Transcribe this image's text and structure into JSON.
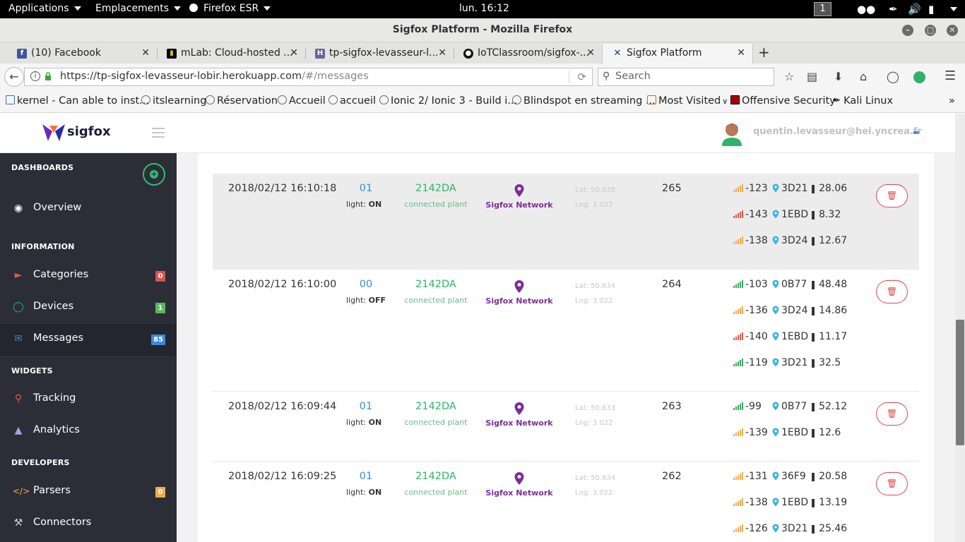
{
  "system_bar": {
    "applications": "Applications",
    "places": "Emplacements",
    "firefox": "Firefox ESR",
    "clock": "lun. 16:12",
    "workspace": "1"
  },
  "window": {
    "title": "Sigfox Platform - Mozilla Firefox"
  },
  "tabs": [
    {
      "label": "(10) Facebook",
      "icon_color": "#3b5998",
      "icon_glyph": "f"
    },
    {
      "label": "mLab: Cloud-hosted ...",
      "icon_color": "#000000",
      "icon_glyph": "▮"
    },
    {
      "label": "tp-sigfox-levasseur-l...",
      "icon_color": "#6762a6",
      "icon_glyph": "H"
    },
    {
      "label": "IoTClassroom/sigfox-...",
      "icon_color": "#111111",
      "icon_glyph": "●"
    },
    {
      "label": "Sigfox Platform",
      "icon_color": "#2a2aa8",
      "icon_glyph": "✕"
    }
  ],
  "navbar": {
    "url_host": "https://tp-sigfox-levasseur-lobir.herokuapp.com",
    "url_path": "/#/messages",
    "search_placeholder": "Search"
  },
  "bookmarks": [
    "kernel - Can able to inst...",
    "itslearning",
    "Réservation",
    "Accueil",
    "accueil",
    "Ionic 2/ Ionic 3 - Build i...",
    "Blindspot en streaming ...",
    "Most Visited",
    "Offensive Security",
    "Kali Linux"
  ],
  "app": {
    "logo_text": "sigfox",
    "user_email": "quentin.levasseur@hei.yncrea.fr"
  },
  "sidebar": {
    "sections": [
      "DASHBOARDS",
      "INFORMATION",
      "WIDGETS",
      "DEVELOPERS"
    ],
    "items": [
      {
        "label": "Overview",
        "icon": "dashboard-icon"
      },
      {
        "label": "Categories",
        "icon": "tag-icon",
        "badge": "0",
        "badge_color": "#d9534f"
      },
      {
        "label": "Devices",
        "icon": "thermometer-icon",
        "badge": "1",
        "badge_color": "#5cb85c"
      },
      {
        "label": "Messages",
        "icon": "envelope-icon",
        "badge": "85",
        "badge_color": "#3a8bd6",
        "active": true
      },
      {
        "label": "Tracking",
        "icon": "map-marker-icon"
      },
      {
        "label": "Analytics",
        "icon": "area-chart-icon"
      },
      {
        "label": "Parsers",
        "icon": "code-icon",
        "badge": "0",
        "badge_color": "#f0ad4e"
      },
      {
        "label": "Connectors",
        "icon": "wrench-icon"
      }
    ]
  },
  "messages": [
    {
      "date": "2018/02/12 16:10:18",
      "data": "01",
      "light_label": "light:",
      "light": "ON",
      "device": "2142DA",
      "device_name": "connected plant",
      "network": "Sigfox Network",
      "lat": "Lat: 50.635",
      "lng": "Lng: 3.022",
      "seq": "265",
      "stations": [
        {
          "rssi": "-123",
          "id": "3D21",
          "snr": "28.06",
          "signal_color": "#f0ad4e"
        },
        {
          "rssi": "-143",
          "id": "1EBD",
          "snr": "8.32",
          "signal_color": "#e05a4a"
        },
        {
          "rssi": "-138",
          "id": "3D24",
          "snr": "12.67",
          "signal_color": "#f0ad4e"
        }
      ]
    },
    {
      "date": "2018/02/12 16:10:00",
      "data": "00",
      "light_label": "light:",
      "light": "OFF",
      "device": "2142DA",
      "device_name": "connected plant",
      "network": "Sigfox Network",
      "lat": "Lat: 50.634",
      "lng": "Lng: 3.022",
      "seq": "264",
      "stations": [
        {
          "rssi": "-103",
          "id": "0B77",
          "snr": "48.48",
          "signal_color": "#3aaa5c"
        },
        {
          "rssi": "-136",
          "id": "3D24",
          "snr": "14.86",
          "signal_color": "#f0ad4e"
        },
        {
          "rssi": "-140",
          "id": "1EBD",
          "snr": "11.17",
          "signal_color": "#e05a4a"
        },
        {
          "rssi": "-119",
          "id": "3D21",
          "snr": "32.5",
          "signal_color": "#3aaa5c"
        }
      ]
    },
    {
      "date": "2018/02/12 16:09:44",
      "data": "01",
      "light_label": "light:",
      "light": "ON",
      "device": "2142DA",
      "device_name": "connected plant",
      "network": "Sigfox Network",
      "lat": "Lat: 50.633",
      "lng": "Lng: 3.022",
      "seq": "263",
      "stations": [
        {
          "rssi": "-99",
          "id": "0B77",
          "snr": "52.12",
          "signal_color": "#3aaa5c"
        },
        {
          "rssi": "-139",
          "id": "1EBD",
          "snr": "12.6",
          "signal_color": "#f0ad4e"
        }
      ]
    },
    {
      "date": "2018/02/12 16:09:25",
      "data": "01",
      "light_label": "light:",
      "light": "ON",
      "device": "2142DA",
      "device_name": "connected plant",
      "network": "Sigfox Network",
      "lat": "Lat: 50.634",
      "lng": "Lng: 3.022",
      "seq": "262",
      "stations": [
        {
          "rssi": "-131",
          "id": "36F9",
          "snr": "20.58",
          "signal_color": "#f0ad4e"
        },
        {
          "rssi": "-138",
          "id": "1EBD",
          "snr": "13.19",
          "signal_color": "#f0ad4e"
        },
        {
          "rssi": "-126",
          "id": "3D21",
          "snr": "25.46",
          "signal_color": "#f0ad4e"
        }
      ]
    }
  ]
}
